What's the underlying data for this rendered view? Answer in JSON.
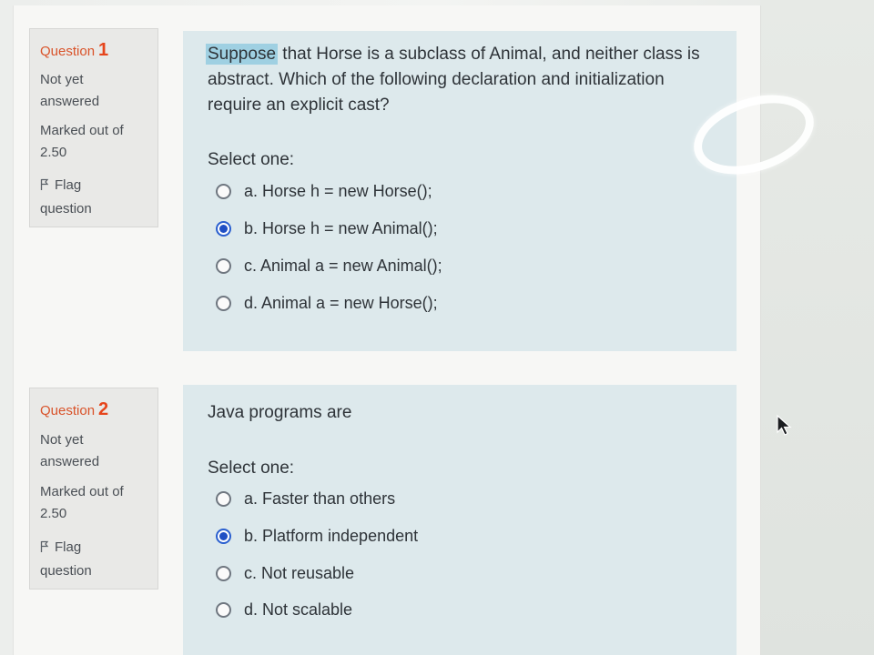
{
  "questions": [
    {
      "label": "Question",
      "number": "1",
      "status_line1": "Not yet",
      "status_line2": "answered",
      "marked_line1": "Marked out of",
      "marked_line2": "2.50",
      "flag_line1": "Flag",
      "flag_line2": "question",
      "text_highlight": "Suppose",
      "text_line1_rest": " that Horse is a subclass of Animal, and neither class is",
      "text_line2": "abstract. Which of the following declaration and initialization",
      "text_line3": "require an explicit cast?",
      "select_label": "Select one:",
      "options": [
        {
          "label": "a. Horse h = new Horse();",
          "checked": false
        },
        {
          "label": "b. Horse h = new Animal();",
          "checked": true
        },
        {
          "label": "c. Animal a = new Animal();",
          "checked": false
        },
        {
          "label": "d. Animal a = new Horse();",
          "checked": false
        }
      ]
    },
    {
      "label": "Question",
      "number": "2",
      "status_line1": "Not yet",
      "status_line2": "answered",
      "marked_line1": "Marked out of",
      "marked_line2": "2.50",
      "flag_line1": "Flag",
      "flag_line2": "question",
      "text_line1": "Java programs are",
      "select_label": "Select one:",
      "options": [
        {
          "label": "a. Faster than others",
          "checked": false
        },
        {
          "label": "b. Platform independent",
          "checked": true
        },
        {
          "label": "c. Not reusable",
          "checked": false
        },
        {
          "label": "d. Not scalable",
          "checked": false
        }
      ]
    }
  ],
  "colors": {
    "question_label": "#d9532a",
    "panel_bg": "#dde9ec",
    "highlight": "#9fd0e2",
    "radio_selected": "#1f4fc4"
  },
  "icons": {
    "flag": "flag-icon",
    "cursor": "mouse-cursor-icon"
  }
}
